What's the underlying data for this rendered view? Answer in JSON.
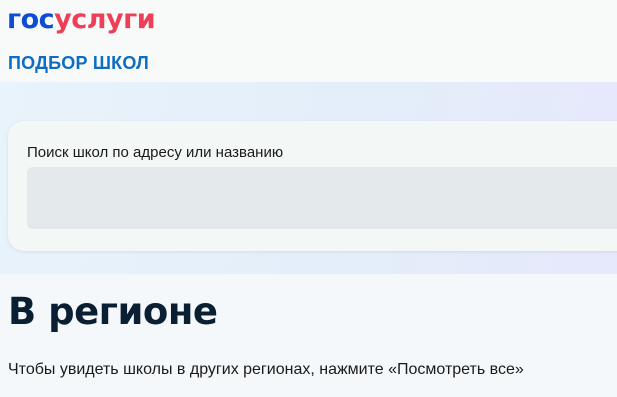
{
  "header": {
    "logo_part1": "гос",
    "logo_part2": "услуги",
    "service_title": "ПОДБОР ШКОЛ"
  },
  "search": {
    "label": "Поиск школ по адресу или названию",
    "value": "",
    "placeholder": ""
  },
  "region": {
    "heading": "В регионе",
    "description": "Чтобы увидеть школы в других регионах, нажмите «Посмотреть все»"
  },
  "colors": {
    "brand_blue": "#0d4cd3",
    "brand_red": "#ee3f58",
    "title_blue": "#0d6cc3",
    "heading_dark": "#0b1f33"
  }
}
